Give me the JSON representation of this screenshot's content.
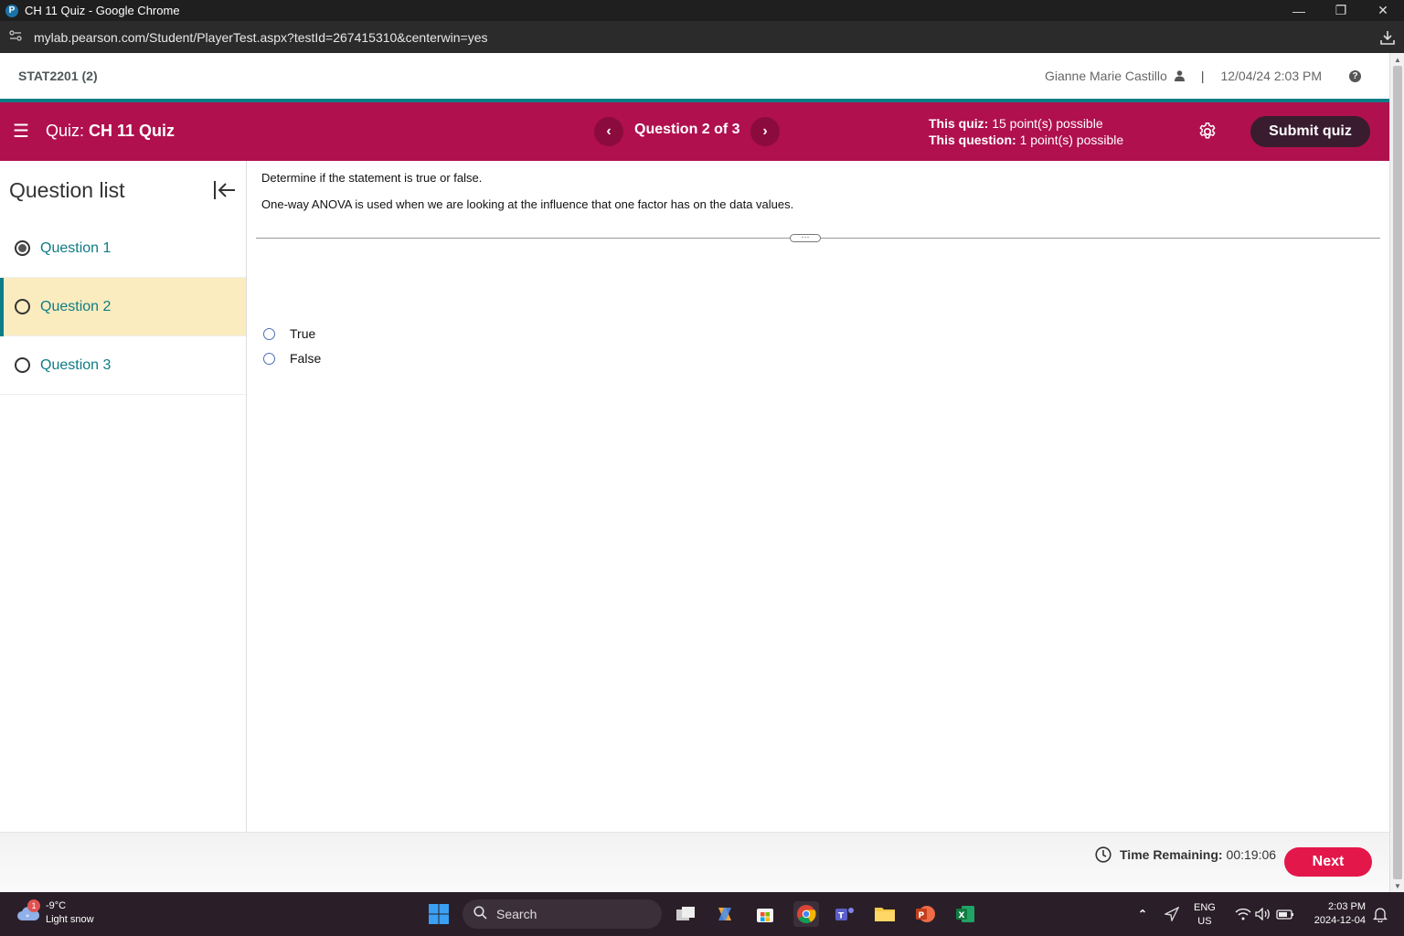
{
  "browser": {
    "window_title": "CH 11 Quiz - Google Chrome",
    "favicon_letter": "P",
    "url": "mylab.pearson.com/Student/PlayerTest.aspx?testId=267415310&centerwin=yes"
  },
  "topbar": {
    "course": "STAT2201 (2)",
    "user_name": "Gianne Marie Castillo",
    "separator": "|",
    "datetime": "12/04/24 2:03 PM"
  },
  "quizbar": {
    "quiz_prefix": "Quiz:",
    "quiz_name": "CH 11 Quiz",
    "question_counter": "Question 2 of 3",
    "quiz_points_label": "This quiz:",
    "quiz_points_value": "15 point(s) possible",
    "question_points_label": "This question:",
    "question_points_value": "1 point(s) possible",
    "submit_label": "Submit quiz"
  },
  "sidebar": {
    "title": "Question list",
    "items": [
      {
        "label": "Question 1",
        "state": "answered"
      },
      {
        "label": "Question 2",
        "state": "current"
      },
      {
        "label": "Question 3",
        "state": "unanswered"
      }
    ]
  },
  "question": {
    "instruction": "Determine if the statement is true or false.",
    "statement": "One-way ANOVA is used when we are looking at the influence that one factor has on the data values.",
    "options": [
      "True",
      "False"
    ]
  },
  "footer": {
    "time_label": "Time Remaining:",
    "time_value": "00:19:06",
    "next_label": "Next"
  },
  "taskbar": {
    "weather_badge": "1",
    "temperature": "-9°C",
    "condition": "Light snow",
    "search_label": "Search",
    "lang_primary": "ENG",
    "lang_secondary": "US",
    "time": "2:03 PM",
    "date": "2024-12-04"
  },
  "colors": {
    "quiz_bar": "#b0104e",
    "teal_accent": "#0e7c86",
    "submit_button": "#3a1c30",
    "next_button": "#e4174b",
    "current_question_bg": "#fbecbf"
  }
}
